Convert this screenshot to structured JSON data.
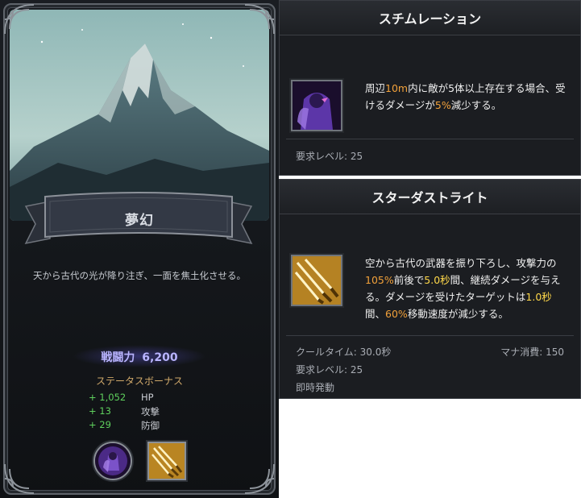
{
  "card": {
    "title": "夢幻",
    "description": "天から古代の光が降り注ぎ、一面を焦土化させる。",
    "power_label": "戦闘力",
    "power_value": "6,200",
    "bonus_title": "ステータスボーナス",
    "stats": [
      {
        "value": "+ 1,052",
        "name": "HP"
      },
      {
        "value": "+ 13",
        "name": "攻撃"
      },
      {
        "value": "+ 29",
        "name": "防御"
      }
    ]
  },
  "skill1": {
    "name": "スチムレーション",
    "desc": [
      {
        "t": "周辺",
        "c": ""
      },
      {
        "t": "10m",
        "c": "o"
      },
      {
        "t": "内に敵が5体以上存在する場合、受けるダメージが",
        "c": ""
      },
      {
        "t": "5%",
        "c": "o"
      },
      {
        "t": "減少する。",
        "c": ""
      }
    ],
    "req_level": "要求レベル: 25"
  },
  "skill2": {
    "name": "スターダストライト",
    "desc": [
      {
        "t": "空から古代の武器を振り下ろし、攻撃力の",
        "c": ""
      },
      {
        "t": "105%",
        "c": "o"
      },
      {
        "t": "前後で",
        "c": ""
      },
      {
        "t": "5.0秒",
        "c": "y"
      },
      {
        "t": "間、継続ダメージを与える。ダメージを受けたターゲットは",
        "c": ""
      },
      {
        "t": "1.0秒",
        "c": "y"
      },
      {
        "t": "間、",
        "c": ""
      },
      {
        "t": "60%",
        "c": "o"
      },
      {
        "t": "移動速度が減少する。",
        "c": ""
      }
    ],
    "cooldown": "クールタイム: 30.0秒",
    "mana": "マナ消費: 150",
    "req_level": "要求レベル: 25",
    "cast": "即時発動"
  },
  "icons": {
    "skill1_icon": "purple-shield-figure-icon",
    "skill2_icon": "golden-swords-icon"
  },
  "colors": {
    "highlight_orange": "#f2a13a",
    "highlight_yellow": "#ffd84a",
    "stat_green": "#5fd15d",
    "power_purple": "#b9b4ff",
    "bonus_gold": "#cfa86a"
  }
}
